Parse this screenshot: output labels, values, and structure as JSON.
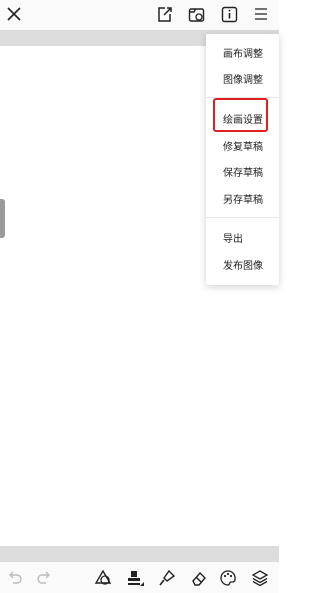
{
  "menu": {
    "items": [
      {
        "label": "画布调整"
      },
      {
        "label": "图像调整"
      },
      {
        "label": "绘画设置"
      },
      {
        "label": "修复草稿"
      },
      {
        "label": "保存草稿"
      },
      {
        "label": "另存草稿"
      },
      {
        "label": "导出"
      },
      {
        "label": "发布图像"
      }
    ],
    "highlighted": "绘画设置"
  },
  "colors": {
    "highlight": "#e02020",
    "gutter": "#dcdcdc",
    "bar": "#fafafa"
  },
  "toolbar_top": {
    "icons": [
      "close-icon",
      "edit-share-icon",
      "image-import-icon",
      "info-icon",
      "menu-icon"
    ]
  },
  "toolbar_bottom": {
    "icons": [
      "undo-icon",
      "redo-icon",
      "shape-icon",
      "stamp-icon",
      "brush-icon",
      "eraser-icon",
      "palette-icon",
      "layers-icon"
    ]
  }
}
